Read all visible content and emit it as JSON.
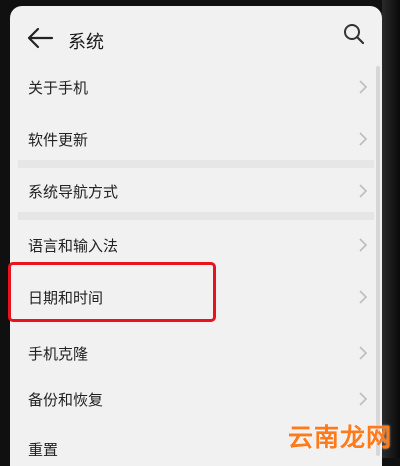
{
  "header": {
    "title": "系统",
    "back_icon": "arrow-left-icon",
    "search_icon": "search-icon"
  },
  "items": [
    {
      "label": "关于手机"
    },
    {
      "label": "软件更新"
    },
    {
      "label": "系统导航方式"
    },
    {
      "label": "语言和输入法"
    },
    {
      "label": "日期和时间"
    },
    {
      "label": "手机克隆"
    },
    {
      "label": "备份和恢复"
    },
    {
      "label": "重置"
    }
  ],
  "watermark": {
    "text": "云南龙网"
  },
  "colors": {
    "background": "#f1f1f1",
    "highlight": "#e8131d",
    "watermark": "#ff7a1a"
  }
}
